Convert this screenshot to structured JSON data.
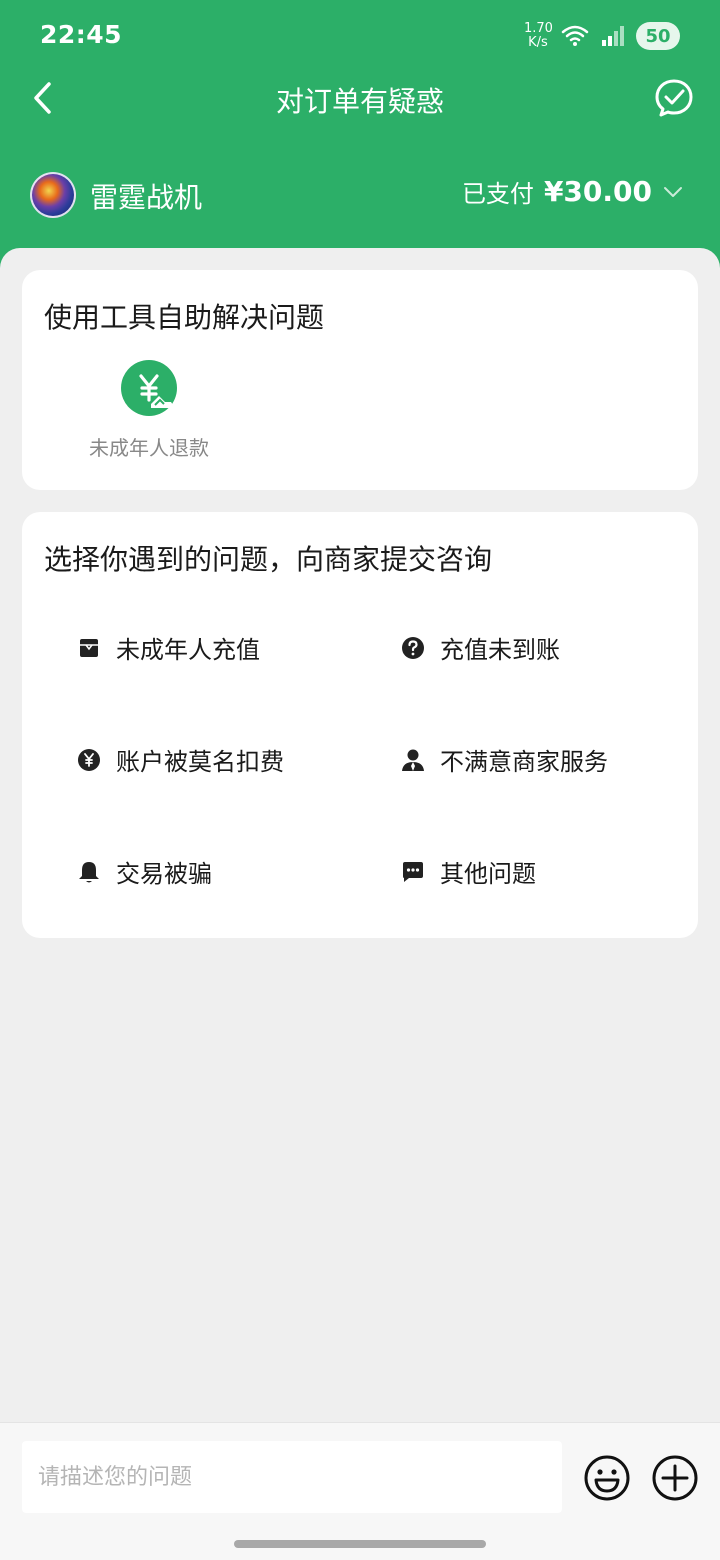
{
  "status_bar": {
    "time": "22:45",
    "net_speed_value": "1.70",
    "net_speed_unit": "K/s",
    "battery": "50"
  },
  "nav": {
    "title": "对订单有疑惑"
  },
  "merchant": {
    "name": "雷霆战机",
    "paid_label": "已支付",
    "paid_amount": "¥30.00"
  },
  "self_help": {
    "title": "使用工具自助解决问题",
    "tools": [
      {
        "label": "未成年人退款",
        "icon": "yuan-refund-icon"
      }
    ]
  },
  "issues": {
    "title": "选择你遇到的问题，向商家提交咨询",
    "items": [
      {
        "label": "未成年人充值",
        "icon": "gift-box-icon"
      },
      {
        "label": "充值未到账",
        "icon": "question-circle-icon"
      },
      {
        "label": "账户被莫名扣费",
        "icon": "yuan-circle-icon"
      },
      {
        "label": "不满意商家服务",
        "icon": "person-icon"
      },
      {
        "label": "交易被骗",
        "icon": "bell-icon"
      },
      {
        "label": "其他问题",
        "icon": "chat-dots-icon"
      }
    ]
  },
  "input_bar": {
    "placeholder": "请描述您的问题"
  },
  "colors": {
    "brand_green": "#2caf68",
    "background": "#efefef",
    "text_primary": "#1a1a1a",
    "text_secondary": "#888888"
  }
}
